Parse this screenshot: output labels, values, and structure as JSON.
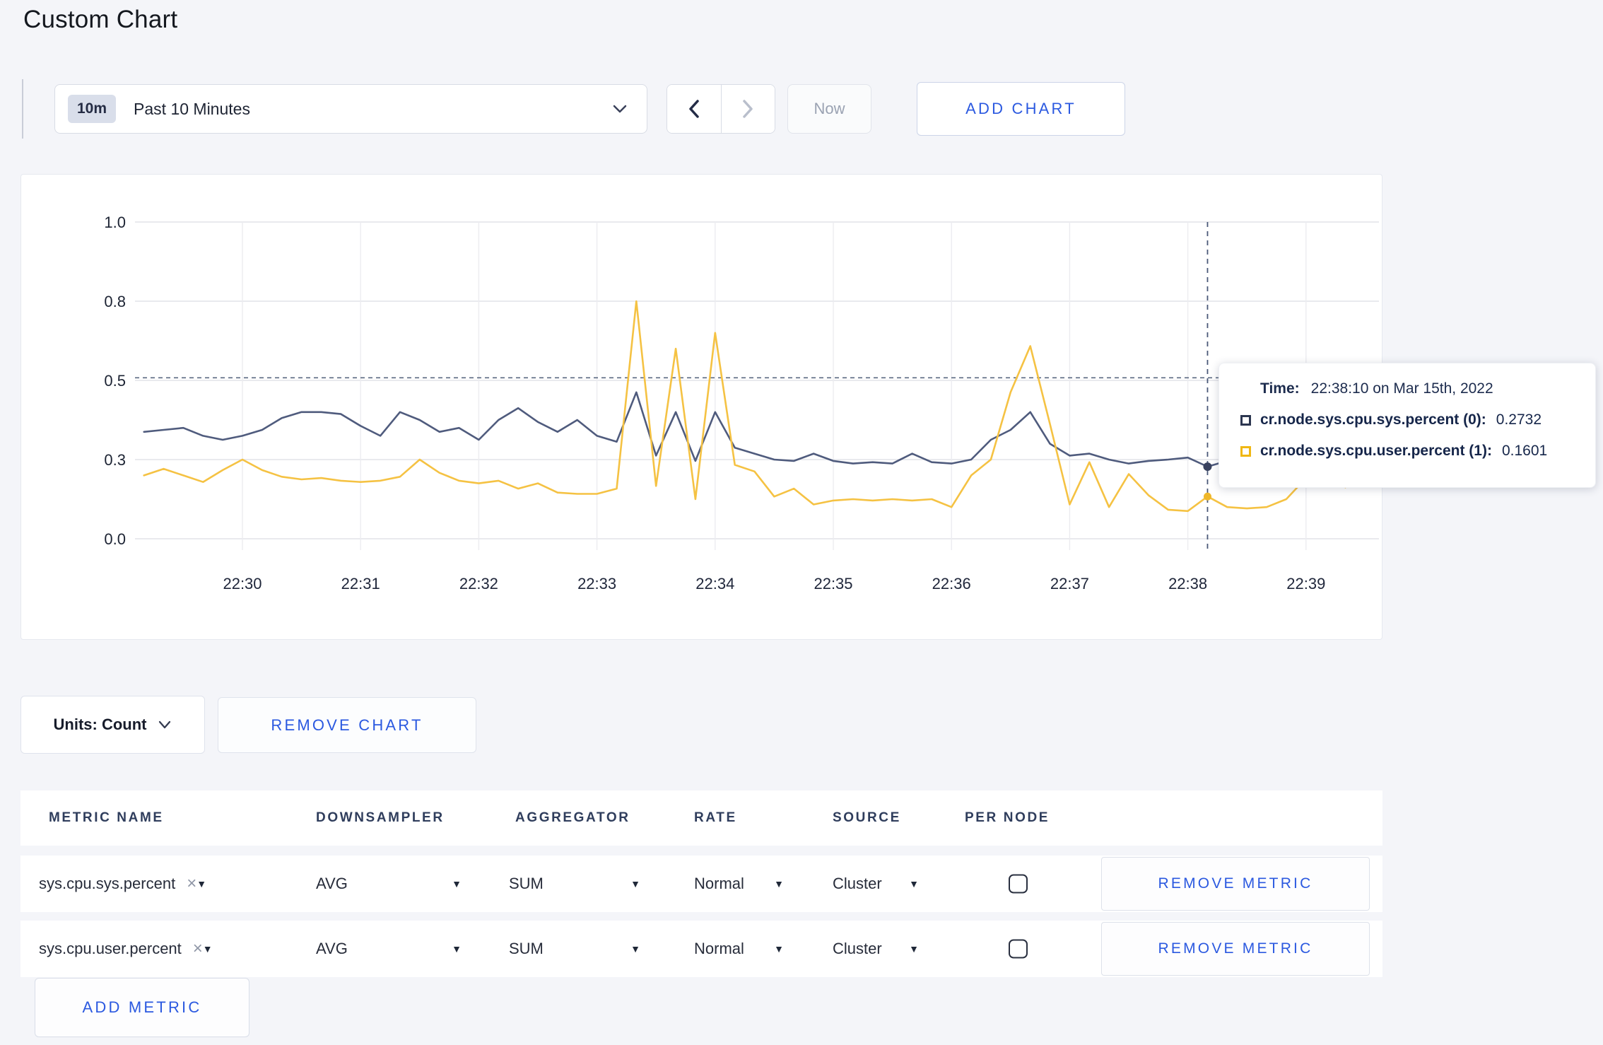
{
  "page": {
    "title": "Custom Chart"
  },
  "toolbar": {
    "time_range": {
      "badge": "10m",
      "label": "Past 10 Minutes"
    },
    "now_label": "Now",
    "add_chart_label": "ADD CHART"
  },
  "chart": {
    "units_label": "Units: Count",
    "remove_chart_label": "REMOVE CHART",
    "tooltip": {
      "time_label": "Time:",
      "time_value": "22:38:10 on Mar 15th, 2022",
      "series": [
        {
          "label": "cr.node.sys.cpu.sys.percent (0):",
          "value": "0.2732",
          "color": "#2c3650"
        },
        {
          "label": "cr.node.sys.cpu.user.percent (1):",
          "value": "0.1601",
          "color": "#f0b713"
        }
      ]
    }
  },
  "chart_data": {
    "type": "line",
    "title": "",
    "xlabel": "",
    "ylabel": "",
    "grid": true,
    "y_tick_values": [
      0.0,
      0.3,
      0.5,
      0.8,
      1.0
    ],
    "y_tick_labels": [
      "0.0",
      "0.3",
      "0.5",
      "0.8",
      "1.0"
    ],
    "x_tick_labels": [
      "22:30",
      "22:31",
      "22:32",
      "22:33",
      "22:34",
      "22:35",
      "22:36",
      "22:37",
      "22:38",
      "22:39"
    ],
    "start_time": "22:29:10",
    "interval_seconds": 10,
    "reference_line_value": 0.51,
    "crosshair_time": "22:38:10",
    "crosshair_index": 54,
    "legend_position": "tooltip",
    "series": [
      {
        "name": "cr.node.sys.cpu.sys.percent (0)",
        "color": "#4f5b7d",
        "values": [
          0.37,
          0.375,
          0.38,
          0.36,
          0.35,
          0.36,
          0.375,
          0.405,
          0.42,
          0.42,
          0.415,
          0.385,
          0.36,
          0.42,
          0.4,
          0.37,
          0.38,
          0.35,
          0.4,
          0.43,
          0.395,
          0.37,
          0.4,
          0.36,
          0.345,
          0.47,
          0.31,
          0.42,
          0.295,
          0.42,
          0.33,
          0.315,
          0.3,
          0.295,
          0.315,
          0.295,
          0.285,
          0.29,
          0.285,
          0.315,
          0.29,
          0.285,
          0.3,
          0.35,
          0.375,
          0.42,
          0.34,
          0.31,
          0.315,
          0.3,
          0.285,
          0.295,
          0.3,
          0.305,
          0.2732,
          0.295,
          0.285,
          0.295,
          0.3,
          0.31,
          0.315,
          0.305,
          0.31
        ]
      },
      {
        "name": "cr.node.sys.cpu.user.percent (1)",
        "color": "#f5c243",
        "values": [
          0.24,
          0.265,
          0.24,
          0.215,
          0.26,
          0.3,
          0.26,
          0.235,
          0.225,
          0.23,
          0.22,
          0.215,
          0.22,
          0.235,
          0.3,
          0.25,
          0.22,
          0.21,
          0.22,
          0.19,
          0.21,
          0.175,
          0.17,
          0.17,
          0.19,
          0.8,
          0.2,
          0.62,
          0.15,
          0.68,
          0.28,
          0.255,
          0.16,
          0.19,
          0.13,
          0.145,
          0.15,
          0.145,
          0.15,
          0.145,
          0.15,
          0.12,
          0.24,
          0.3,
          0.47,
          0.63,
          0.39,
          0.13,
          0.29,
          0.12,
          0.245,
          0.165,
          0.11,
          0.105,
          0.1601,
          0.12,
          0.115,
          0.12,
          0.15,
          0.23,
          0.27,
          0.195,
          0.26
        ]
      }
    ],
    "crosshair_values": {
      "sys": 0.2732,
      "user": 0.1601
    }
  },
  "metrics_table": {
    "headers": [
      "METRIC NAME",
      "DOWNSAMPLER",
      "AGGREGATOR",
      "RATE",
      "SOURCE",
      "PER NODE"
    ],
    "rows": [
      {
        "name": "sys.cpu.sys.percent",
        "downsampler": "AVG",
        "aggregator": "SUM",
        "rate": "Normal",
        "source": "Cluster",
        "per_node_checked": false,
        "remove_label": "REMOVE METRIC"
      },
      {
        "name": "sys.cpu.user.percent",
        "downsampler": "AVG",
        "aggregator": "SUM",
        "rate": "Normal",
        "source": "Cluster",
        "per_node_checked": false,
        "remove_label": "REMOVE METRIC"
      }
    ],
    "add_metric_label": "ADD METRIC"
  }
}
